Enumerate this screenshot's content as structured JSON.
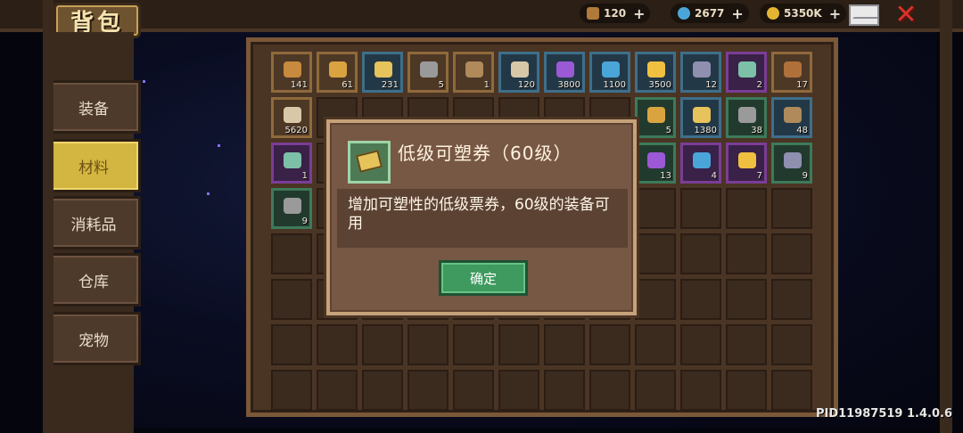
{
  "header": {
    "title": "背包",
    "resources": [
      {
        "icon": "wood-icon",
        "value": "120",
        "color": "#b07a3a"
      },
      {
        "icon": "blue-gem-icon",
        "value": "2677",
        "color": "#4aa6d8"
      },
      {
        "icon": "gold-coin-icon",
        "value": "5350K",
        "color": "#e2b431"
      }
    ]
  },
  "tabs": [
    {
      "label": "装备",
      "active": false
    },
    {
      "label": "材料",
      "active": true
    },
    {
      "label": "消耗品",
      "active": false
    },
    {
      "label": "仓库",
      "active": false
    },
    {
      "label": "宠物",
      "active": false
    }
  ],
  "inventory": {
    "rows": [
      [
        "141",
        "61",
        "231",
        "5",
        "1",
        "120",
        "3800",
        "1100",
        "3500",
        "12",
        "2",
        "17"
      ],
      [
        "5620",
        "",
        "",
        "",
        "",
        "",
        "",
        "",
        "5",
        "1380",
        "38",
        "48"
      ],
      [
        "1",
        "",
        "",
        "",
        "",
        "",
        "",
        "",
        "13",
        "4",
        "7",
        "9"
      ],
      [
        "9",
        "",
        "",
        "",
        "",
        "",
        "",
        "",
        "",
        "",
        "",
        ""
      ]
    ]
  },
  "dialog": {
    "title": "低级可塑券（60级）",
    "description": "增加可塑性的低级票券，60级的装备可用",
    "confirm_label": "确定"
  },
  "footer": {
    "pid": "PID11987519 1.4.0.6"
  }
}
